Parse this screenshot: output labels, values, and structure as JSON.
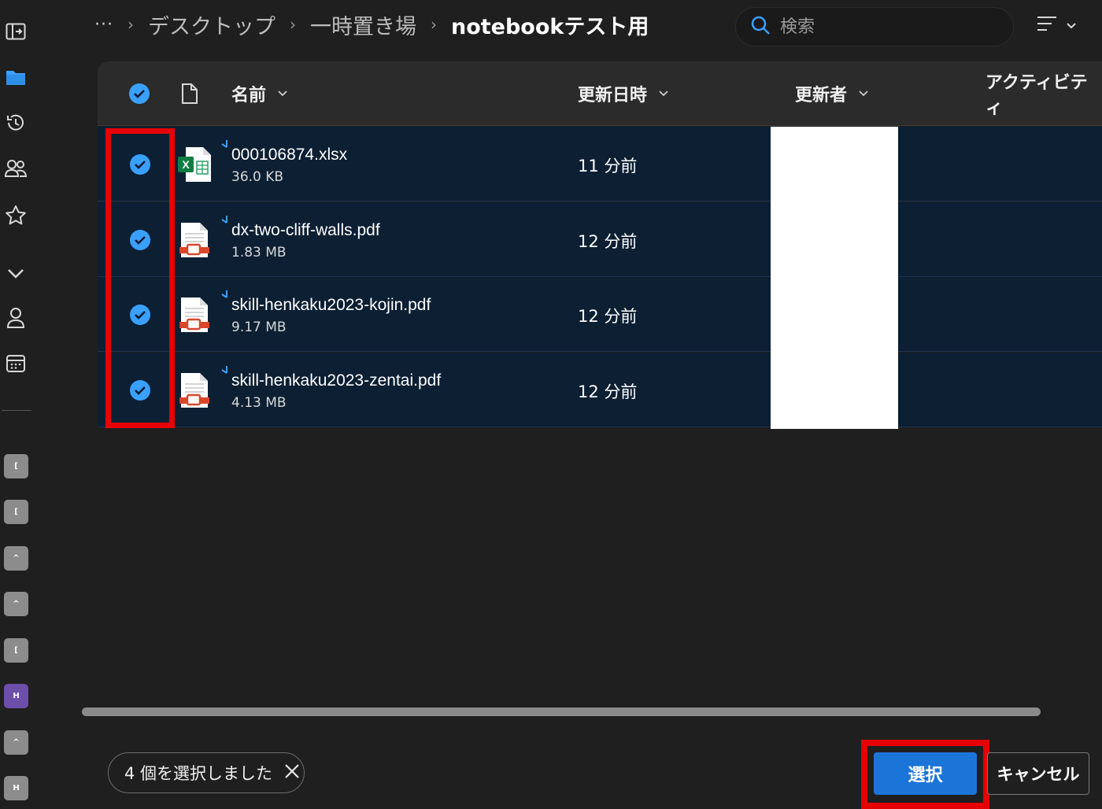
{
  "breadcrumb": {
    "more": "···",
    "items": [
      "デスクトップ",
      "一時置き場"
    ],
    "current": "notebookテスト用"
  },
  "search": {
    "placeholder": "検索"
  },
  "columns": {
    "name": "名前",
    "modified": "更新日時",
    "modified_by": "更新者",
    "activity": "アクティビティ"
  },
  "files": [
    {
      "name": "000106874.xlsx",
      "size": "36.0 KB",
      "modified": "11 分前",
      "type": "xlsx",
      "selected": true
    },
    {
      "name": "dx-two-cliff-walls.pdf",
      "size": "1.83 MB",
      "modified": "12 分前",
      "type": "pdf",
      "selected": true
    },
    {
      "name": "skill-henkaku2023-kojin.pdf",
      "size": "9.17 MB",
      "modified": "12 分前",
      "type": "pdf",
      "selected": true
    },
    {
      "name": "skill-henkaku2023-zentai.pdf",
      "size": "4.13 MB",
      "modified": "12 分前",
      "type": "pdf",
      "selected": true
    }
  ],
  "rail_tiles": [
    "[",
    "[",
    "^",
    "^",
    "[",
    "H",
    "^",
    "H"
  ],
  "footer": {
    "selection_status": "4 個を選択しました",
    "select_label": "選択",
    "cancel_label": "キャンセル"
  },
  "colors": {
    "accent": "#1b75d9",
    "check": "#3aa0ff",
    "selected_row": "#0c1f33",
    "highlight": "#e60000"
  }
}
